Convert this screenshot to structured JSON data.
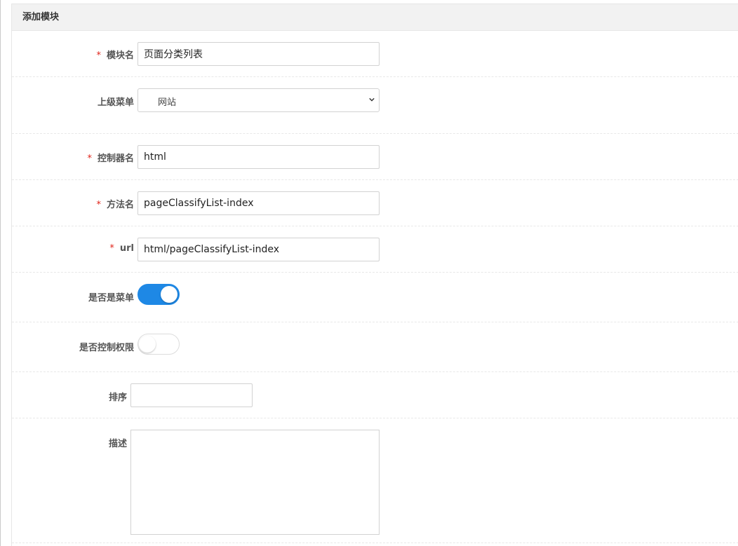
{
  "panel": {
    "title": "添加模块"
  },
  "form": {
    "module_name": {
      "label": "模块名",
      "required_mark": "*",
      "value": "页面分类列表"
    },
    "parent_menu": {
      "label": "上级菜单",
      "selected": "网站"
    },
    "controller_name": {
      "label": "控制器名",
      "required_mark": "*",
      "value": "html"
    },
    "method_name": {
      "label": "方法名",
      "required_mark": "*",
      "value": "pageClassifyList-index"
    },
    "url": {
      "label": "url",
      "required_mark": "*",
      "value": "html/pageClassifyList-index"
    },
    "is_menu": {
      "label": "是否是菜单",
      "on": true
    },
    "control_permission": {
      "label": "是否控制权限",
      "on": false
    },
    "sort": {
      "label": "排序",
      "value": ""
    },
    "description": {
      "label": "描述",
      "value": ""
    }
  },
  "colors": {
    "accent": "#1e88e5",
    "required": "#e1251b"
  }
}
